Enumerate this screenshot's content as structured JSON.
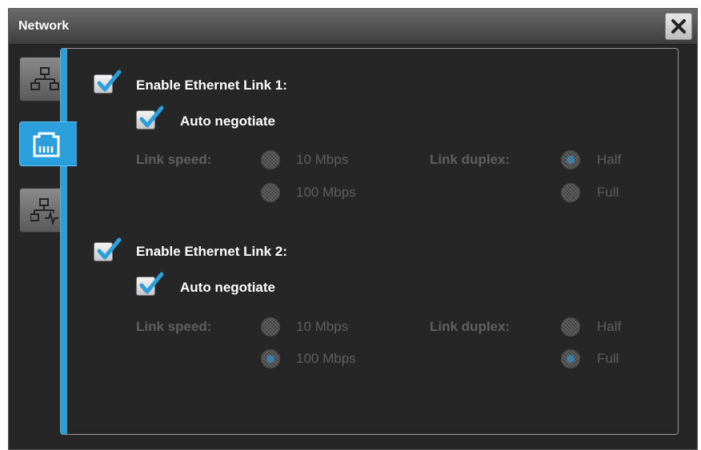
{
  "window": {
    "title": "Network"
  },
  "tabs": [
    {
      "icon": "network-topology-icon",
      "active": false
    },
    {
      "icon": "ethernet-port-icon",
      "active": true
    },
    {
      "icon": "network-diagnostics-icon",
      "active": false
    }
  ],
  "links": [
    {
      "enable_label": "Enable Ethernet Link 1:",
      "enabled": true,
      "auto_label": "Auto negotiate",
      "auto": true,
      "speed_label": "Link speed:",
      "speed_options": [
        "10 Mbps",
        "100 Mbps"
      ],
      "speed_selected": "none",
      "duplex_label": "Link duplex:",
      "duplex_options": [
        "Half",
        "Full"
      ],
      "duplex_selected": "Half"
    },
    {
      "enable_label": "Enable Ethernet Link 2:",
      "enabled": true,
      "auto_label": "Auto negotiate",
      "auto": true,
      "speed_label": "Link speed:",
      "speed_options": [
        "10 Mbps",
        "100 Mbps"
      ],
      "speed_selected": "100 Mbps",
      "duplex_label": "Link duplex:",
      "duplex_options": [
        "Half",
        "Full"
      ],
      "duplex_selected": "Full"
    }
  ],
  "colors": {
    "accent": "#2b9fdc",
    "background": "#262626",
    "disabled_text": "#5f5f5f"
  }
}
